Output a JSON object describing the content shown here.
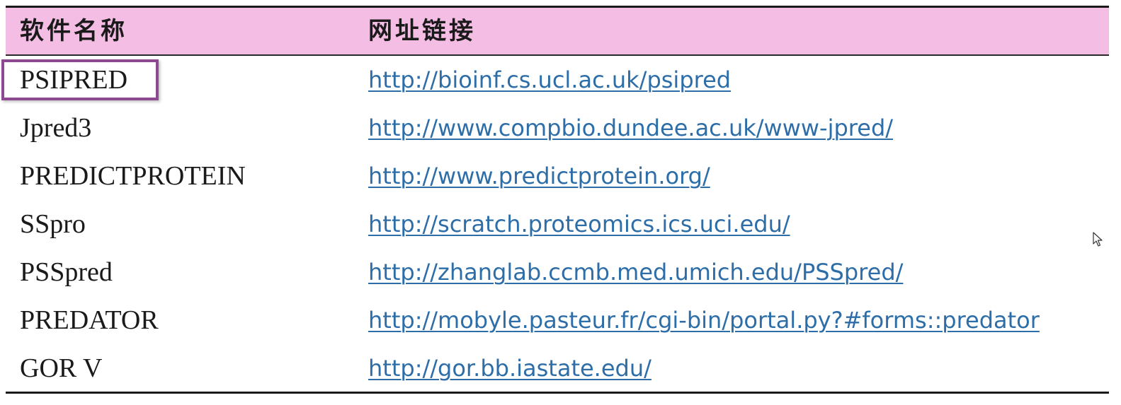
{
  "table": {
    "headers": {
      "name": "软件名称",
      "url": "网址链接"
    },
    "rows": [
      {
        "name": "PSIPRED",
        "url": "http://bioinf.cs.ucl.ac.uk/psipred"
      },
      {
        "name": "Jpred3",
        "url": "http://www.compbio.dundee.ac.uk/www-jpred/"
      },
      {
        "name": "PREDICTPROTEIN",
        "url": "http://www.predictprotein.org/"
      },
      {
        "name": "SSpro",
        "url": "http://scratch.proteomics.ics.uci.edu/"
      },
      {
        "name": "PSSpred",
        "url": "http://zhanglab.ccmb.med.umich.edu/PSSpred/"
      },
      {
        "name": "PREDATOR",
        "url": "http://mobyle.pasteur.fr/cgi-bin/portal.py?#forms::predator"
      },
      {
        "name": "GOR V",
        "url": "http://gor.bb.iastate.edu/"
      }
    ],
    "highlighted_row": "PSIPRED"
  },
  "colors": {
    "header_bg": "#f4bde4",
    "link": "#2e6ea8",
    "highlight_border": "#8e4a90",
    "rule": "#1a1a1a"
  },
  "icons": {
    "cursor": "mouse-pointer-icon"
  }
}
